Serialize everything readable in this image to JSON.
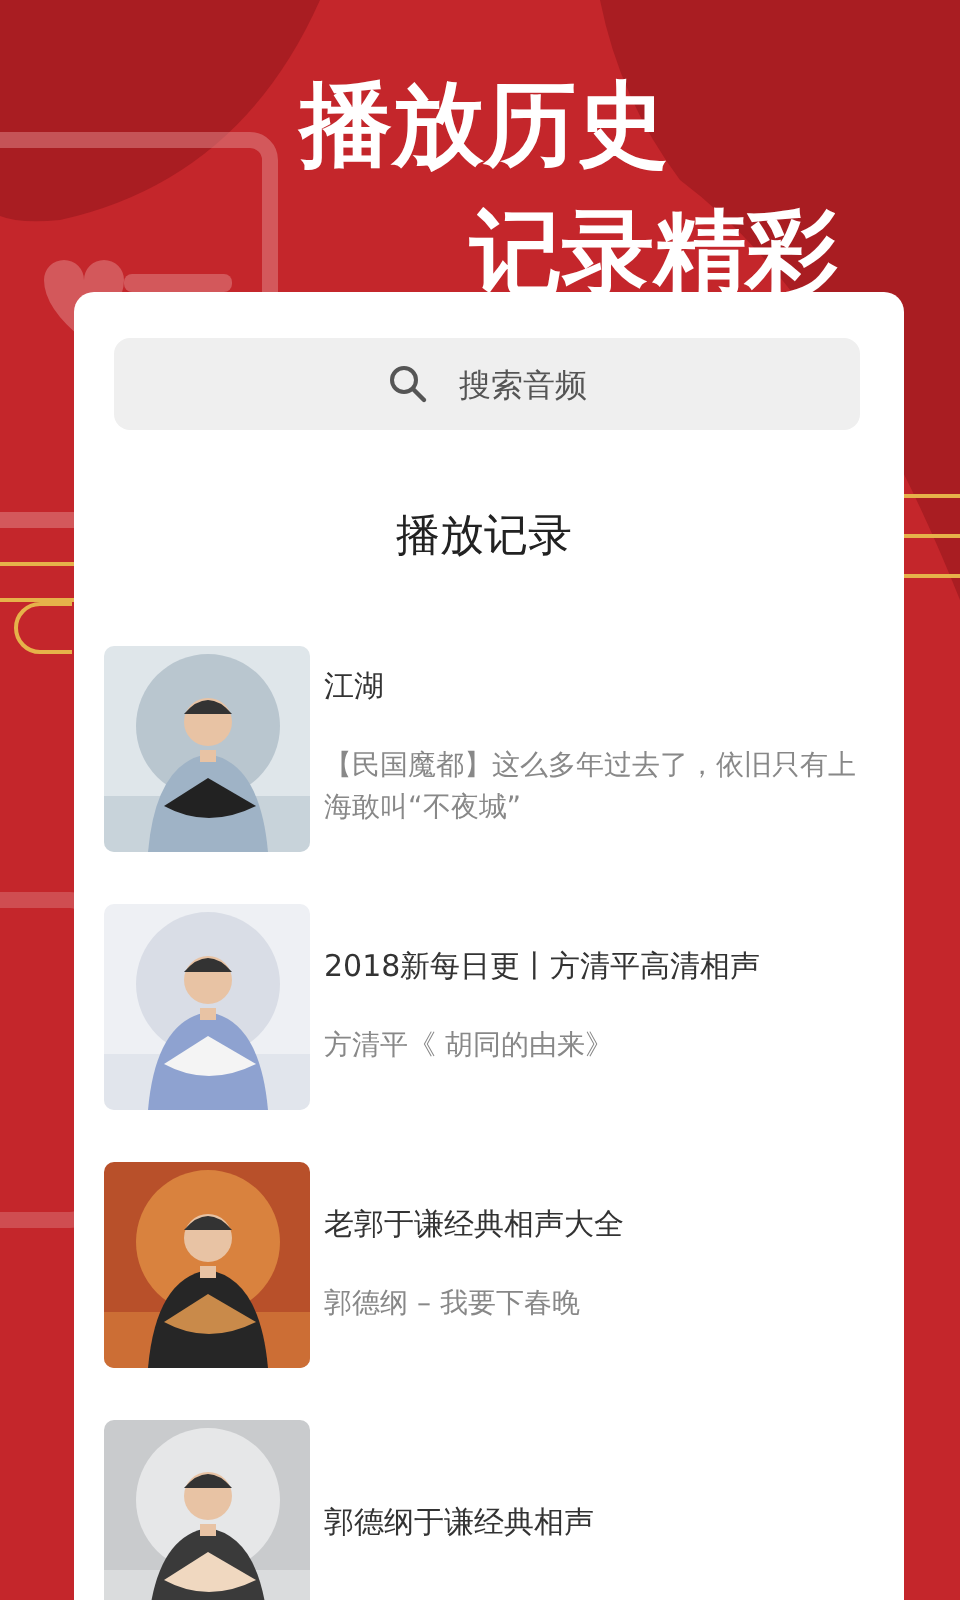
{
  "headline": [
    "播放历史",
    "记录精彩"
  ],
  "search": {
    "placeholder": "搜索音频"
  },
  "section_title": "播放记录",
  "records": [
    {
      "title": "江湖",
      "subtitle": "【民国魔都】这么多年过去了，依旧只有上海敢叫“不夜城”"
    },
    {
      "title": "2018新每日更丨方清平高清相声",
      "subtitle": "方清平《 胡同的由来》"
    },
    {
      "title": "老郭于谦经典相声大全",
      "subtitle": "郭德纲 – 我要下春晚"
    },
    {
      "title": "郭德纲于谦经典相声"
    }
  ]
}
